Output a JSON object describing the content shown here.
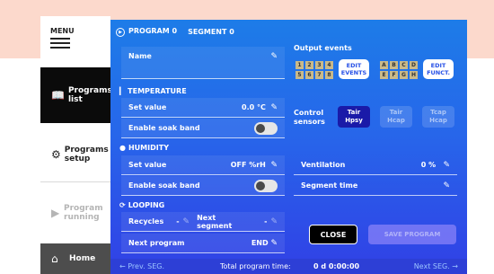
{
  "sidebar": {
    "menu_label": "MENU",
    "items": [
      {
        "label": "Programs list",
        "icon": "book-icon"
      },
      {
        "label": "Programs setup",
        "icon": "gear-icon"
      },
      {
        "label": "Program running",
        "icon": "play-circle-icon"
      },
      {
        "label": "Home",
        "icon": "home-icon"
      }
    ]
  },
  "header": {
    "program_label": "PROGRAM 0",
    "segment_label": "SEGMENT 0"
  },
  "name_label": "Name",
  "temperature": {
    "section_label": "TEMPERATURE",
    "set_value_label": "Set value",
    "set_value": "0.0",
    "unit": "°C",
    "soak_band_label": "Enable soak band"
  },
  "humidity": {
    "section_label": "HUMIDITY",
    "set_value_label": "Set value",
    "set_value": "OFF",
    "unit": "%rH",
    "soak_band_label": "Enable soak band"
  },
  "looping": {
    "section_label": "LOOPING",
    "recycles_label": "Recycles",
    "recycles_value": "-",
    "next_segment_label": "Next segment",
    "next_segment_value": "-",
    "next_program_label": "Next program",
    "next_program_value": "END"
  },
  "output_events": {
    "label": "Output events",
    "numbers": [
      "1",
      "2",
      "3",
      "4",
      "5",
      "6",
      "7",
      "8"
    ],
    "letters": [
      "A",
      "B",
      "C",
      "D",
      "E",
      "F",
      "G",
      "H"
    ],
    "edit_events_line1": "EDIT",
    "edit_events_line2": "EVENTS",
    "edit_funct_line1": "EDIT",
    "edit_funct_line2": "FUNCT."
  },
  "control_sensors": {
    "label_line1": "Control",
    "label_line2": "sensors",
    "options": [
      {
        "line1": "Tair",
        "line2": "Hpsy",
        "active": true
      },
      {
        "line1": "Tair",
        "line2": "Hcap",
        "active": false
      },
      {
        "line1": "Tcap",
        "line2": "Hcap",
        "active": false
      }
    ]
  },
  "ventilation": {
    "label": "Ventilation",
    "value": "0",
    "unit": "%"
  },
  "segment_time": {
    "label": "Segment time"
  },
  "buttons": {
    "close": "CLOSE",
    "save": "SAVE PROGRAM"
  },
  "footer": {
    "prev": "Prev. SEG.",
    "total_label": "Total program time:",
    "total_value": "0 d  0:00:00",
    "next": "Next SEG."
  },
  "colors": {
    "panel_top": "#1d7ce8",
    "panel_bottom": "#3140e6",
    "active_sensor": "#1a1aa8",
    "peach": "#fcd9cc"
  }
}
